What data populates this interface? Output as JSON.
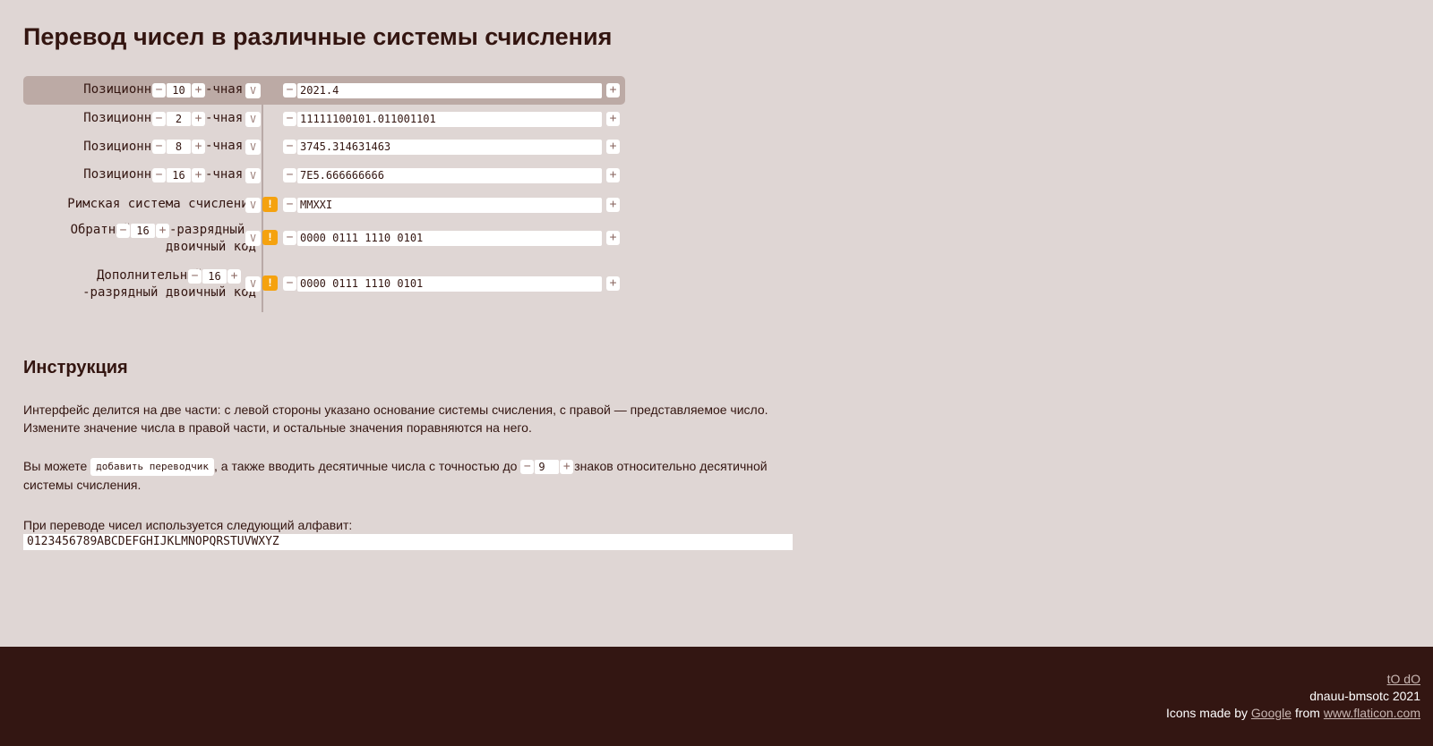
{
  "title": "Перевод чисел в различные системы счисления",
  "converter": {
    "rows": [
      {
        "label": "Позиционная",
        "base": "10",
        "suffix": "-чная",
        "value": "2021.4",
        "v_label": "V"
      },
      {
        "label": "Позиционная",
        "base": "2",
        "suffix": "-чная",
        "value": "11111100101.011001101",
        "v_label": "V"
      },
      {
        "label": "Позиционная",
        "base": "8",
        "suffix": "-чная",
        "value": "3745.314631463",
        "v_label": "V"
      },
      {
        "label": "Позиционная",
        "base": "16",
        "suffix": "-чная",
        "value": "7E5.666666666",
        "v_label": "V"
      },
      {
        "label": "Римская система счисления",
        "value": "MMXXI",
        "v_label": "V",
        "warning": "!"
      },
      {
        "label": "Обратный",
        "bits": "16",
        "suffix": "-разрядный",
        "label2": "двоичный код",
        "value": "0000 0111 1110 0101",
        "v_label": "V",
        "warning": "!"
      },
      {
        "label": "Дополнительный",
        "bits": "16",
        "label2": "-разрядный двоичный код",
        "value": "0000 0111 1110 0101",
        "v_label": "V",
        "warning": "!"
      }
    ],
    "minus": "−",
    "plus": "+"
  },
  "instructions": {
    "heading": "Инструкция",
    "p1_line1": "Интерфейс делится на две части: с левой стороны указано основание системы счисления, с правой — представляемое число.",
    "p1_line2": "Измените значение числа в правой части, и остальные значения поравняются на него.",
    "p2_pre": "Вы можете",
    "add_button": "добавить переводчик",
    "p2_mid": ", а также вводить десятичные числа с точностью до",
    "precision": "9",
    "p2_post": "знаков относительно десятичной",
    "p2_line2": "системы счисления.",
    "p3": "При переводе чисел используется следующий алфавит:",
    "alphabet": "0123456789ABCDEFGHIJKLMNOPQRSTUVWXYZ"
  },
  "footer": {
    "todo_link": "tO dO",
    "copyright": "dnauu-bmsotc 2021",
    "icons_pre": "Icons made by",
    "google_link": "Google",
    "icons_mid": "from",
    "flaticon_link": "www.flaticon.com"
  }
}
